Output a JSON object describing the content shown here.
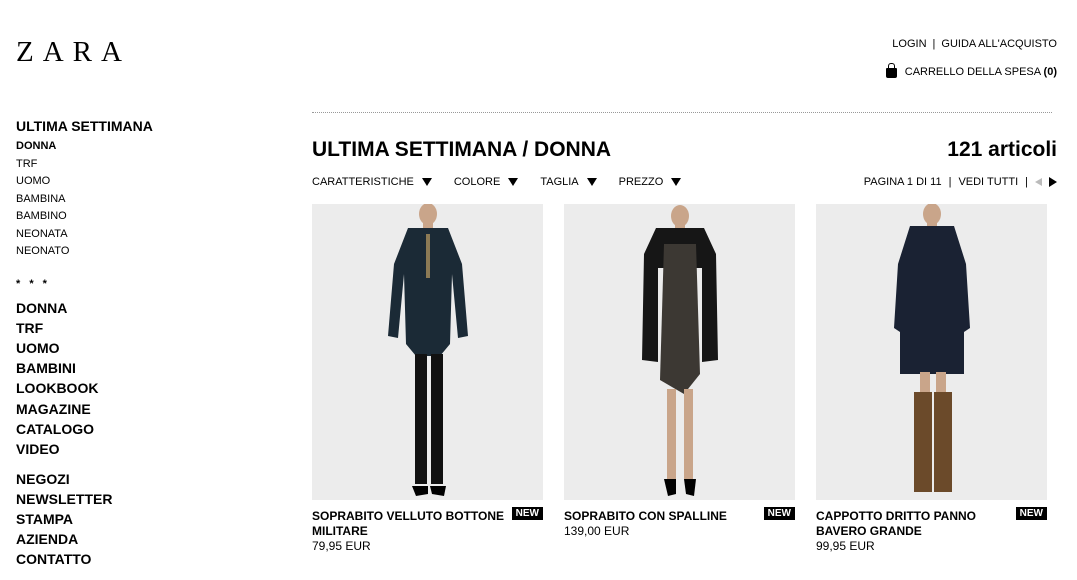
{
  "brand": "ZARA",
  "header": {
    "login": "LOGIN",
    "separator": "|",
    "guide": "GUIDA ALL'ACQUISTO",
    "cart_label": "CARRELLO DELLA SPESA",
    "cart_count": "(0)"
  },
  "sidebar": {
    "section_title": "ULTIMA SETTIMANA",
    "sub_items": [
      "DONNA",
      "TRF",
      "UOMO",
      "BAMBINA",
      "BAMBINO",
      "NEONATA",
      "NEONATO"
    ],
    "stars": "* * *",
    "main_items": [
      "DONNA",
      "TRF",
      "UOMO",
      "BAMBINI",
      "LOOKBOOK",
      "MAGAZINE",
      "CATALOGO",
      "VIDEO"
    ],
    "info_items": [
      "NEGOZI",
      "NEWSLETTER",
      "STAMPA",
      "AZIENDA",
      "CONTATTO"
    ]
  },
  "main": {
    "title": "ULTIMA SETTIMANA / DONNA",
    "count": "121 articoli",
    "filters": [
      "CARATTERISTICHE",
      "COLORE",
      "TAGLIA",
      "PREZZO"
    ],
    "pagination": {
      "page": "PAGINA 1 DI 11",
      "separator": "|",
      "view_all": "VEDI TUTTI"
    },
    "products": [
      {
        "name": "SOPRABITO VELLUTO BOTTONE MILITARE",
        "price": "79,95 EUR",
        "badge": "NEW"
      },
      {
        "name": "SOPRABITO CON SPALLINE",
        "price": "139,00 EUR",
        "badge": "NEW"
      },
      {
        "name": "CAPPOTTO DRITTO PANNO BAVERO GRANDE",
        "price": "99,95 EUR",
        "badge": "NEW"
      }
    ]
  },
  "colors": {
    "text": "#000000",
    "background": "#ffffff",
    "photo_bg": "#ececec",
    "coat1": "#1b2a36",
    "coat2": "#161616",
    "coat3": "#1a2233",
    "dress": "#3c3833",
    "boots": "#6b4a2a"
  }
}
